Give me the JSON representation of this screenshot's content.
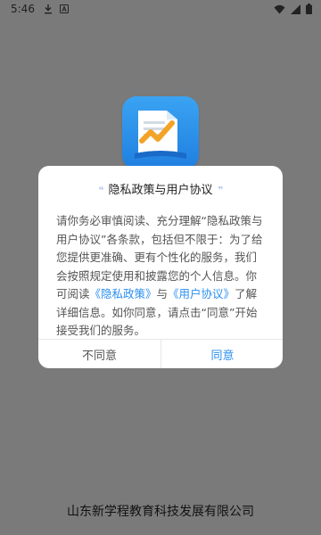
{
  "status_bar": {
    "time": "5:46",
    "left_icons": [
      "download-icon",
      "app-a-icon"
    ],
    "right_icons": [
      "wifi-icon",
      "signal-icon",
      "battery-icon"
    ]
  },
  "app_icon": {
    "name": "app-logo"
  },
  "dialog": {
    "title": "隐私政策与用户协议",
    "body": {
      "part1": "请你务必审慎阅读、充分理解“隐私政策与用户协议”各条款，包括但不限于：为了给您提供更准确、更有个性化的服务，我们会按照规定使用和披露您的个人信息。你可阅读",
      "privacy_link": "《隐私政策》",
      "and": "与",
      "agreement_link": "《用户协议》",
      "part2": "了解详细信息。如你同意，请点击“同意”开始接受我们的服务。"
    },
    "buttons": {
      "disagree": "不同意",
      "agree": "同意"
    }
  },
  "footer": {
    "company": "山东新学程教育科技发展有限公司"
  },
  "colors": {
    "overlay": "#7a7a7a",
    "link": "#2a8ef2",
    "icon_blue": "#2b8ff0"
  }
}
